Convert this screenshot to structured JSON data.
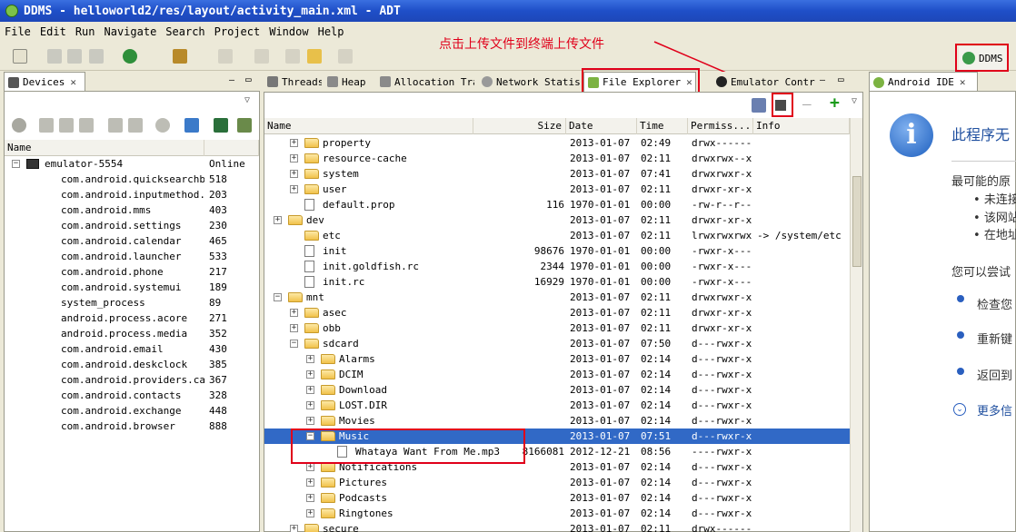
{
  "window": {
    "title": "DDMS - helloworld2/res/layout/activity_main.xml - ADT"
  },
  "menu": [
    "File",
    "Edit",
    "Run",
    "Navigate",
    "Search",
    "Project",
    "Window",
    "Help"
  ],
  "annotation": {
    "text": "点击上传文件到终端上传文件"
  },
  "perspective": {
    "label": "DDMS"
  },
  "devices_panel": {
    "tab_label": "Devices",
    "col_name": "Name",
    "device": {
      "name": "emulator-5554",
      "status": "Online"
    },
    "processes": [
      {
        "name": "com.android.quicksearchbox",
        "pid": "518"
      },
      {
        "name": "com.android.inputmethod.la",
        "pid": "203"
      },
      {
        "name": "com.android.mms",
        "pid": "403"
      },
      {
        "name": "com.android.settings",
        "pid": "230"
      },
      {
        "name": "com.android.calendar",
        "pid": "465"
      },
      {
        "name": "com.android.launcher",
        "pid": "533"
      },
      {
        "name": "com.android.phone",
        "pid": "217"
      },
      {
        "name": "com.android.systemui",
        "pid": "189"
      },
      {
        "name": "system_process",
        "pid": "89"
      },
      {
        "name": "android.process.acore",
        "pid": "271"
      },
      {
        "name": "android.process.media",
        "pid": "352"
      },
      {
        "name": "com.android.email",
        "pid": "430"
      },
      {
        "name": "com.android.deskclock",
        "pid": "385"
      },
      {
        "name": "com.android.providers.cale",
        "pid": "367"
      },
      {
        "name": "com.android.contacts",
        "pid": "328"
      },
      {
        "name": "com.android.exchange",
        "pid": "448"
      },
      {
        "name": "com.android.browser",
        "pid": "888"
      }
    ]
  },
  "tabs": [
    "Threads",
    "Heap",
    "Allocation Tra",
    "Network Statis",
    "File Explorer",
    "Emulator Contr"
  ],
  "file_explorer": {
    "columns": [
      "Name",
      "Size",
      "Date",
      "Time",
      "Permiss...",
      "Info"
    ],
    "rows": [
      {
        "name": "property",
        "expander": "+",
        "type": "folder",
        "indent": 1,
        "size": "",
        "date": "2013-01-07",
        "time": "02:49",
        "perm": "drwx------",
        "info": ""
      },
      {
        "name": "resource-cache",
        "expander": "+",
        "type": "folder",
        "indent": 1,
        "size": "",
        "date": "2013-01-07",
        "time": "02:11",
        "perm": "drwxrwx--x",
        "info": ""
      },
      {
        "name": "system",
        "expander": "+",
        "type": "folder",
        "indent": 1,
        "size": "",
        "date": "2013-01-07",
        "time": "07:41",
        "perm": "drwxrwxr-x",
        "info": ""
      },
      {
        "name": "user",
        "expander": "+",
        "type": "folder",
        "indent": 1,
        "size": "",
        "date": "2013-01-07",
        "time": "02:11",
        "perm": "drwxr-xr-x",
        "info": ""
      },
      {
        "name": "default.prop",
        "expander": "",
        "type": "file",
        "indent": 1,
        "size": "116",
        "date": "1970-01-01",
        "time": "00:00",
        "perm": "-rw-r--r--",
        "info": ""
      },
      {
        "name": "dev",
        "expander": "+",
        "type": "folder",
        "indent": 0,
        "size": "",
        "date": "2013-01-07",
        "time": "02:11",
        "perm": "drwxr-xr-x",
        "info": ""
      },
      {
        "name": "etc",
        "expander": "",
        "type": "folder",
        "indent": 1,
        "size": "",
        "date": "2013-01-07",
        "time": "02:11",
        "perm": "lrwxrwxrwx",
        "info": "-> /system/etc"
      },
      {
        "name": "init",
        "expander": "",
        "type": "file",
        "indent": 1,
        "size": "98676",
        "date": "1970-01-01",
        "time": "00:00",
        "perm": "-rwxr-x---",
        "info": ""
      },
      {
        "name": "init.goldfish.rc",
        "expander": "",
        "type": "file",
        "indent": 1,
        "size": "2344",
        "date": "1970-01-01",
        "time": "00:00",
        "perm": "-rwxr-x---",
        "info": ""
      },
      {
        "name": "init.rc",
        "expander": "",
        "type": "file",
        "indent": 1,
        "size": "16929",
        "date": "1970-01-01",
        "time": "00:00",
        "perm": "-rwxr-x---",
        "info": ""
      },
      {
        "name": "mnt",
        "expander": "−",
        "type": "folder",
        "indent": 0,
        "size": "",
        "date": "2013-01-07",
        "time": "02:11",
        "perm": "drwxrwxr-x",
        "info": ""
      },
      {
        "name": "asec",
        "expander": "+",
        "type": "folder",
        "indent": 1,
        "size": "",
        "date": "2013-01-07",
        "time": "02:11",
        "perm": "drwxr-xr-x",
        "info": ""
      },
      {
        "name": "obb",
        "expander": "+",
        "type": "folder",
        "indent": 1,
        "size": "",
        "date": "2013-01-07",
        "time": "02:11",
        "perm": "drwxr-xr-x",
        "info": ""
      },
      {
        "name": "sdcard",
        "expander": "−",
        "type": "folder",
        "indent": 1,
        "size": "",
        "date": "2013-01-07",
        "time": "07:50",
        "perm": "d---rwxr-x",
        "info": ""
      },
      {
        "name": "Alarms",
        "expander": "+",
        "type": "folder",
        "indent": 2,
        "size": "",
        "date": "2013-01-07",
        "time": "02:14",
        "perm": "d---rwxr-x",
        "info": ""
      },
      {
        "name": "DCIM",
        "expander": "+",
        "type": "folder",
        "indent": 2,
        "size": "",
        "date": "2013-01-07",
        "time": "02:14",
        "perm": "d---rwxr-x",
        "info": ""
      },
      {
        "name": "Download",
        "expander": "+",
        "type": "folder",
        "indent": 2,
        "size": "",
        "date": "2013-01-07",
        "time": "02:14",
        "perm": "d---rwxr-x",
        "info": ""
      },
      {
        "name": "LOST.DIR",
        "expander": "+",
        "type": "folder",
        "indent": 2,
        "size": "",
        "date": "2013-01-07",
        "time": "02:14",
        "perm": "d---rwxr-x",
        "info": ""
      },
      {
        "name": "Movies",
        "expander": "+",
        "type": "folder",
        "indent": 2,
        "size": "",
        "date": "2013-01-07",
        "time": "02:14",
        "perm": "d---rwxr-x",
        "info": ""
      },
      {
        "name": "Music",
        "expander": "−",
        "type": "folder",
        "indent": 2,
        "size": "",
        "date": "2013-01-07",
        "time": "07:51",
        "perm": "d---rwxr-x",
        "info": "",
        "selected": true
      },
      {
        "name": "Whataya Want From Me.mp3",
        "expander": "",
        "type": "file",
        "indent": 3,
        "size": "8166081",
        "date": "2012-12-21",
        "time": "08:56",
        "perm": "----rwxr-x",
        "info": ""
      },
      {
        "name": "Notifications",
        "expander": "+",
        "type": "folder",
        "indent": 2,
        "size": "",
        "date": "2013-01-07",
        "time": "02:14",
        "perm": "d---rwxr-x",
        "info": ""
      },
      {
        "name": "Pictures",
        "expander": "+",
        "type": "folder",
        "indent": 2,
        "size": "",
        "date": "2013-01-07",
        "time": "02:14",
        "perm": "d---rwxr-x",
        "info": ""
      },
      {
        "name": "Podcasts",
        "expander": "+",
        "type": "folder",
        "indent": 2,
        "size": "",
        "date": "2013-01-07",
        "time": "02:14",
        "perm": "d---rwxr-x",
        "info": ""
      },
      {
        "name": "Ringtones",
        "expander": "+",
        "type": "folder",
        "indent": 2,
        "size": "",
        "date": "2013-01-07",
        "time": "02:14",
        "perm": "d---rwxr-x",
        "info": ""
      },
      {
        "name": "secure",
        "expander": "+",
        "type": "folder",
        "indent": 1,
        "size": "",
        "date": "2013-01-07",
        "time": "02:11",
        "perm": "drwx------",
        "info": ""
      }
    ]
  },
  "right_panel": {
    "tab_label": "Android IDE",
    "heading": "此程序无",
    "reason_title": "最可能的原",
    "bullets": [
      "未连接",
      "该网站",
      "在地址"
    ],
    "try_text": "您可以尝试",
    "actions": [
      "检查您",
      "重新键",
      "返回到",
      "更多信"
    ]
  },
  "colors": {
    "selection": "#3169c6",
    "highlight": "#e0001a",
    "title_bar": "#1f4fc8"
  }
}
